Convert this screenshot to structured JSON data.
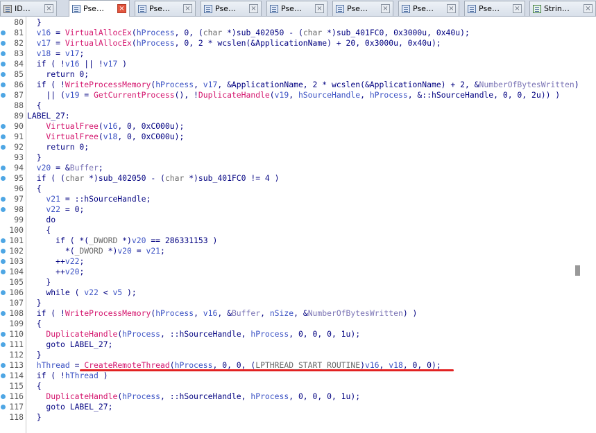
{
  "tabs": [
    {
      "label": "ID…",
      "icon": "ida-view-icon"
    },
    {
      "label": "Pse…",
      "icon": "pseudocode-icon",
      "active": true
    },
    {
      "label": "Pse…",
      "icon": "pseudocode-icon"
    },
    {
      "label": "Pse…",
      "icon": "pseudocode-icon"
    },
    {
      "label": "Pse…",
      "icon": "pseudocode-icon"
    },
    {
      "label": "Pse…",
      "icon": "pseudocode-icon"
    },
    {
      "label": "Pse…",
      "icon": "pseudocode-icon"
    },
    {
      "label": "Pse…",
      "icon": "pseudocode-icon"
    },
    {
      "label": "Strin…",
      "icon": "strings-icon"
    }
  ],
  "colors": {
    "function": "#d4166e",
    "variable": "#3b52c4",
    "global": "#7b74b5",
    "keyword": "#000080",
    "highlight": "#e22222",
    "breakpoint_dot": "#4ea6e4"
  },
  "lines": [
    {
      "n": "80",
      "dot": false,
      "tokens": [
        [
          "k",
          "  }"
        ]
      ]
    },
    {
      "n": "81",
      "dot": true,
      "tokens": [
        [
          "v",
          "  v16"
        ],
        [
          "k",
          " = "
        ],
        [
          "f",
          "VirtualAllocEx"
        ],
        [
          "k",
          "("
        ],
        [
          "v",
          "hProcess"
        ],
        [
          "k",
          ", 0, ("
        ],
        [
          "t",
          "char"
        ],
        [
          "k",
          " *)sub_402050 - ("
        ],
        [
          "t",
          "char"
        ],
        [
          "k",
          " *)sub_401FC0, 0x3000u, 0x40u);"
        ]
      ]
    },
    {
      "n": "82",
      "dot": true,
      "tokens": [
        [
          "v",
          "  v17"
        ],
        [
          "k",
          " = "
        ],
        [
          "f",
          "VirtualAllocEx"
        ],
        [
          "k",
          "("
        ],
        [
          "v",
          "hProcess"
        ],
        [
          "k",
          ", 0, 2 * wcslen(&ApplicationName) + 20, 0x3000u, 0x40u);"
        ]
      ]
    },
    {
      "n": "83",
      "dot": true,
      "tokens": [
        [
          "v",
          "  v18"
        ],
        [
          "k",
          " = "
        ],
        [
          "v",
          "v17"
        ],
        [
          "k",
          ";"
        ]
      ]
    },
    {
      "n": "84",
      "dot": true,
      "tokens": [
        [
          "k",
          "  if ( !"
        ],
        [
          "v",
          "v16"
        ],
        [
          "k",
          " || !"
        ],
        [
          "v",
          "v17"
        ],
        [
          "k",
          " )"
        ]
      ]
    },
    {
      "n": "85",
      "dot": true,
      "tokens": [
        [
          "k",
          "    return 0;"
        ]
      ]
    },
    {
      "n": "86",
      "dot": true,
      "tokens": [
        [
          "k",
          "  if ( !"
        ],
        [
          "f",
          "WriteProcessMemory"
        ],
        [
          "k",
          "("
        ],
        [
          "v",
          "hProcess"
        ],
        [
          "k",
          ", "
        ],
        [
          "v",
          "v17"
        ],
        [
          "k",
          ", &ApplicationName, 2 * wcslen(&ApplicationName) + 2, &"
        ],
        [
          "g",
          "NumberOfBytesWritten"
        ],
        [
          "k",
          ")"
        ]
      ]
    },
    {
      "n": "87",
      "dot": true,
      "tokens": [
        [
          "k",
          "    || ("
        ],
        [
          "v",
          "v19"
        ],
        [
          "k",
          " = "
        ],
        [
          "f",
          "GetCurrentProcess"
        ],
        [
          "k",
          "(), !"
        ],
        [
          "f",
          "DuplicateHandle"
        ],
        [
          "k",
          "("
        ],
        [
          "v",
          "v19"
        ],
        [
          "k",
          ", "
        ],
        [
          "v",
          "hSourceHandle"
        ],
        [
          "k",
          ", "
        ],
        [
          "v",
          "hProcess"
        ],
        [
          "k",
          ", &::hSourceHandle, 0, 0, 2u)) )"
        ]
      ]
    },
    {
      "n": "88",
      "dot": false,
      "tokens": [
        [
          "k",
          "  {"
        ]
      ]
    },
    {
      "n": "89",
      "dot": false,
      "tokens": [
        [
          "k",
          "LABEL_27:"
        ]
      ]
    },
    {
      "n": "90",
      "dot": true,
      "tokens": [
        [
          "f",
          "    VirtualFree"
        ],
        [
          "k",
          "("
        ],
        [
          "v",
          "v16"
        ],
        [
          "k",
          ", 0, 0xC000u);"
        ]
      ]
    },
    {
      "n": "91",
      "dot": true,
      "tokens": [
        [
          "f",
          "    VirtualFree"
        ],
        [
          "k",
          "("
        ],
        [
          "v",
          "v18"
        ],
        [
          "k",
          ", 0, 0xC000u);"
        ]
      ]
    },
    {
      "n": "92",
      "dot": true,
      "tokens": [
        [
          "k",
          "    return 0;"
        ]
      ]
    },
    {
      "n": "93",
      "dot": false,
      "tokens": [
        [
          "k",
          "  }"
        ]
      ]
    },
    {
      "n": "94",
      "dot": true,
      "tokens": [
        [
          "v",
          "  v20"
        ],
        [
          "k",
          " = &"
        ],
        [
          "g",
          "Buffer"
        ],
        [
          "k",
          ";"
        ]
      ]
    },
    {
      "n": "95",
      "dot": true,
      "tokens": [
        [
          "k",
          "  if ( ("
        ],
        [
          "t",
          "char"
        ],
        [
          "k",
          " *)sub_402050 - ("
        ],
        [
          "t",
          "char"
        ],
        [
          "k",
          " *)sub_401FC0 != 4 )"
        ]
      ]
    },
    {
      "n": "96",
      "dot": false,
      "tokens": [
        [
          "k",
          "  {"
        ]
      ]
    },
    {
      "n": "97",
      "dot": true,
      "tokens": [
        [
          "v",
          "    v21"
        ],
        [
          "k",
          " = ::hSourceHandle;"
        ]
      ]
    },
    {
      "n": "98",
      "dot": true,
      "tokens": [
        [
          "v",
          "    v22"
        ],
        [
          "k",
          " = 0;"
        ]
      ]
    },
    {
      "n": "99",
      "dot": false,
      "tokens": [
        [
          "k",
          "    do"
        ]
      ]
    },
    {
      "n": "100",
      "dot": false,
      "tokens": [
        [
          "k",
          "    {"
        ]
      ]
    },
    {
      "n": "101",
      "dot": true,
      "tokens": [
        [
          "k",
          "      if ( *("
        ],
        [
          "t",
          "_DWORD"
        ],
        [
          "k",
          " *)"
        ],
        [
          "v",
          "v20"
        ],
        [
          "k",
          " == 286331153 )"
        ]
      ]
    },
    {
      "n": "102",
      "dot": true,
      "tokens": [
        [
          "k",
          "        *("
        ],
        [
          "t",
          "_DWORD"
        ],
        [
          "k",
          " *)"
        ],
        [
          "v",
          "v20"
        ],
        [
          "k",
          " = "
        ],
        [
          "v",
          "v21"
        ],
        [
          "k",
          ";"
        ]
      ]
    },
    {
      "n": "103",
      "dot": true,
      "tokens": [
        [
          "k",
          "      ++"
        ],
        [
          "v",
          "v22"
        ],
        [
          "k",
          ";"
        ]
      ]
    },
    {
      "n": "104",
      "dot": true,
      "tokens": [
        [
          "k",
          "      ++"
        ],
        [
          "v",
          "v20"
        ],
        [
          "k",
          ";"
        ]
      ]
    },
    {
      "n": "105",
      "dot": false,
      "tokens": [
        [
          "k",
          "    }"
        ]
      ]
    },
    {
      "n": "106",
      "dot": true,
      "tokens": [
        [
          "k",
          "    while ( "
        ],
        [
          "v",
          "v22"
        ],
        [
          "k",
          " < "
        ],
        [
          "v",
          "v5"
        ],
        [
          "k",
          " );"
        ]
      ]
    },
    {
      "n": "107",
      "dot": false,
      "tokens": [
        [
          "k",
          "  }"
        ]
      ]
    },
    {
      "n": "108",
      "dot": true,
      "tokens": [
        [
          "k",
          "  if ( !"
        ],
        [
          "f",
          "WriteProcessMemory"
        ],
        [
          "k",
          "("
        ],
        [
          "v",
          "hProcess"
        ],
        [
          "k",
          ", "
        ],
        [
          "v",
          "v16"
        ],
        [
          "k",
          ", &"
        ],
        [
          "g",
          "Buffer"
        ],
        [
          "k",
          ", "
        ],
        [
          "v",
          "nSize"
        ],
        [
          "k",
          ", &"
        ],
        [
          "g",
          "NumberOfBytesWritten"
        ],
        [
          "k",
          ") )"
        ]
      ]
    },
    {
      "n": "109",
      "dot": false,
      "tokens": [
        [
          "k",
          "  {"
        ]
      ]
    },
    {
      "n": "110",
      "dot": true,
      "tokens": [
        [
          "f",
          "    DuplicateHandle"
        ],
        [
          "k",
          "("
        ],
        [
          "v",
          "hProcess"
        ],
        [
          "k",
          ", ::hSourceHandle, "
        ],
        [
          "v",
          "hProcess"
        ],
        [
          "k",
          ", 0, 0, 0, 1u);"
        ]
      ]
    },
    {
      "n": "111",
      "dot": true,
      "tokens": [
        [
          "k",
          "    goto LABEL_27;"
        ]
      ]
    },
    {
      "n": "112",
      "dot": false,
      "tokens": [
        [
          "k",
          "  }"
        ]
      ]
    },
    {
      "n": "113",
      "dot": true,
      "tokens": [
        [
          "v",
          "  hThread"
        ],
        [
          "k",
          " = "
        ],
        [
          "f",
          "CreateRemoteThread"
        ],
        [
          "k",
          "("
        ],
        [
          "v",
          "hProcess"
        ],
        [
          "k",
          ", 0, 0, ("
        ],
        [
          "t",
          "LPTHREAD_START_ROUTINE"
        ],
        [
          "k",
          ")"
        ],
        [
          "v",
          "v16"
        ],
        [
          "k",
          ", "
        ],
        [
          "v",
          "v18"
        ],
        [
          "k",
          ", 0, 0);"
        ]
      ]
    },
    {
      "n": "114",
      "dot": true,
      "tokens": [
        [
          "k",
          "  if ( !"
        ],
        [
          "v",
          "hThread"
        ],
        [
          "k",
          " )"
        ]
      ]
    },
    {
      "n": "115",
      "dot": false,
      "tokens": [
        [
          "k",
          "  {"
        ]
      ]
    },
    {
      "n": "116",
      "dot": true,
      "tokens": [
        [
          "f",
          "    DuplicateHandle"
        ],
        [
          "k",
          "("
        ],
        [
          "v",
          "hProcess"
        ],
        [
          "k",
          ", ::hSourceHandle, "
        ],
        [
          "v",
          "hProcess"
        ],
        [
          "k",
          ", 0, 0, 0, 1u);"
        ]
      ]
    },
    {
      "n": "117",
      "dot": true,
      "tokens": [
        [
          "k",
          "    goto LABEL_27;"
        ]
      ]
    },
    {
      "n": "118",
      "dot": false,
      "tokens": [
        [
          "k",
          "  }"
        ]
      ]
    }
  ]
}
